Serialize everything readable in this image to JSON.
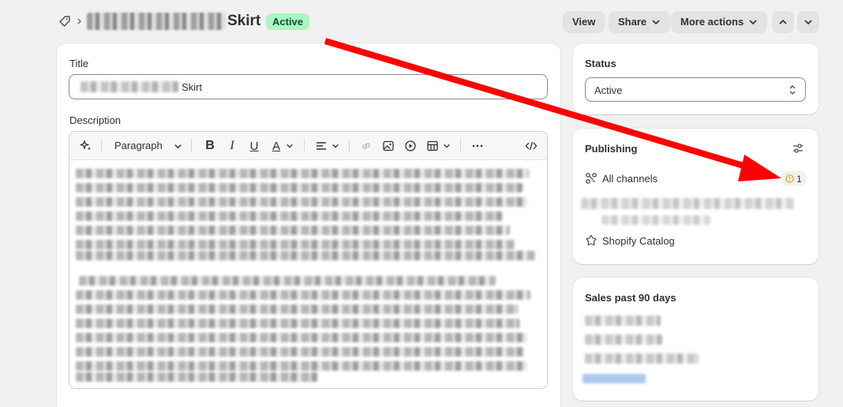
{
  "header": {
    "title_suffix": "Skirt",
    "status_badge": "Active",
    "buttons": {
      "view": "View",
      "share": "Share",
      "more_actions": "More actions"
    }
  },
  "main": {
    "title_label": "Title",
    "title_value_suffix": "Skirt",
    "description_label": "Description",
    "toolbar": {
      "paragraph": "Paragraph"
    }
  },
  "sidebar": {
    "status": {
      "heading": "Status",
      "value": "Active"
    },
    "publishing": {
      "heading": "Publishing",
      "all_channels": "All channels",
      "warning_count": "1",
      "shopify_catalog": "Shopify Catalog"
    },
    "sales": {
      "heading": "Sales past 90 days"
    }
  },
  "colors": {
    "annotation_arrow": "#ff0000",
    "badge_bg": "#aff5c3",
    "warning": "#e8a400"
  }
}
